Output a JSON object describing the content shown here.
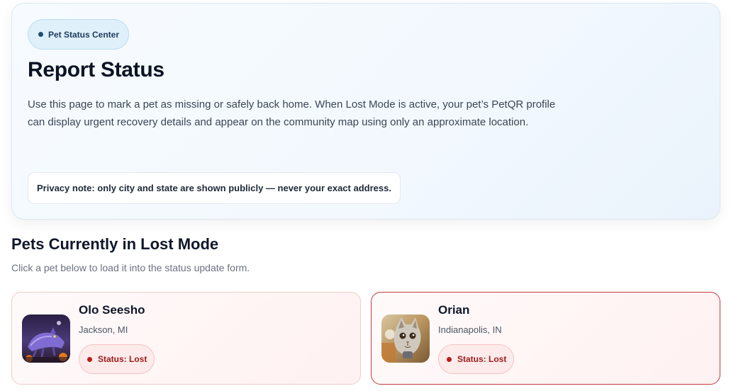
{
  "hero": {
    "pill_label": "Pet Status Center",
    "title": "Report Status",
    "description": "Use this page to mark a pet as missing or safely back home. When Lost Mode is active, your pet’s PetQR profile can display urgent recovery details and appear on the community map using only an approximate location.",
    "privacy_note": "Privacy note: only city and state are shown publicly — never your exact address."
  },
  "lost_section": {
    "title": "Pets Currently in Lost Mode",
    "subtitle": "Click a pet below to load it into the status update form.",
    "pets": [
      {
        "name": "Olo Seesho",
        "location": "Jackson, MI",
        "status": "Status: Lost",
        "selected": false,
        "photo": "pet-photo-cat-halloween"
      },
      {
        "name": "Orian",
        "location": "Indianapolis, IN",
        "status": "Status: Lost",
        "selected": true,
        "photo": "pet-photo-cat-closeup"
      }
    ]
  },
  "colors": {
    "lost_accent": "#c53a3a",
    "status_text": "#991b1b",
    "pill_bg": "#dff0fb"
  }
}
